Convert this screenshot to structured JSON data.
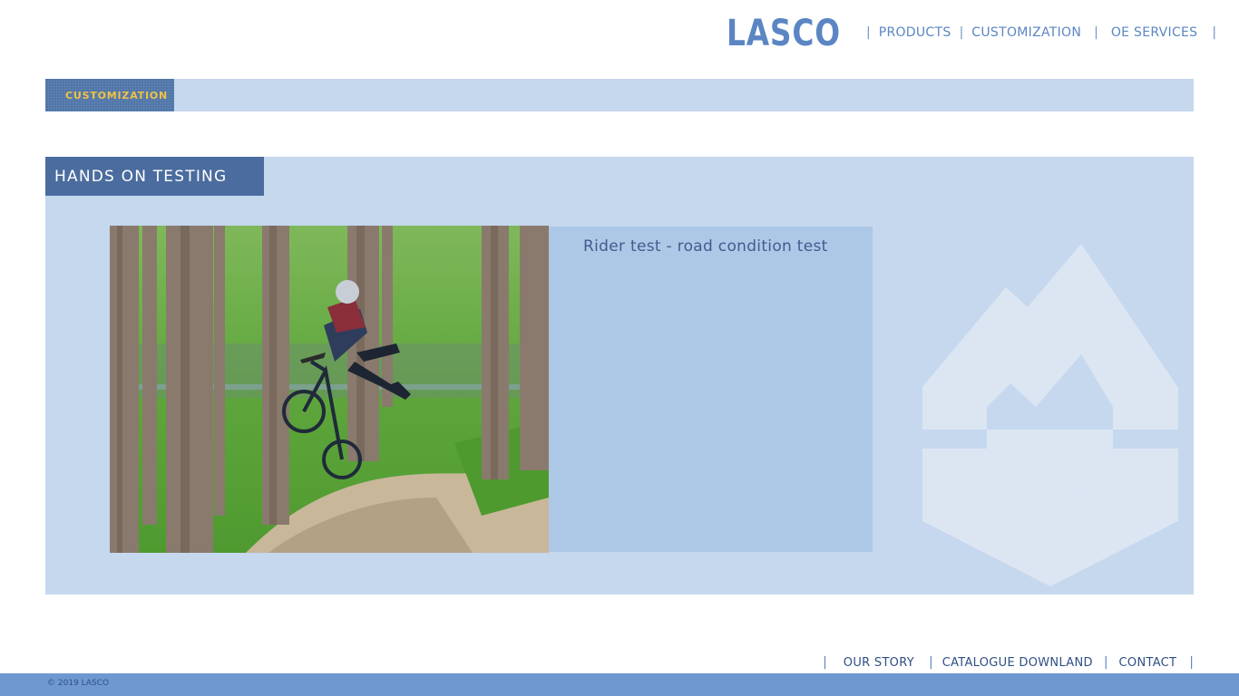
{
  "header": {
    "logo_text": "LASCO",
    "nav": [
      {
        "label": "PRODUCTS"
      },
      {
        "label": "CUSTOMIZATION"
      },
      {
        "label": "OE SERVICES"
      }
    ]
  },
  "breadcrumb": {
    "current": "CUSTOMIZATION"
  },
  "section": {
    "title": "HANDS ON TESTING",
    "caption": "Rider test - road condition test"
  },
  "footer": {
    "nav": [
      {
        "label": "OUR STORY"
      },
      {
        "label": "CATALOGUE DOWNLAND"
      },
      {
        "label": "CONTACT"
      }
    ],
    "copyright": "© 2019 LASCO"
  },
  "colors": {
    "brand_blue": "#5b86c3",
    "panel_bg": "#c5d8ee",
    "title_bg": "#4b6c9e",
    "accent_yellow": "#f0c243",
    "footer_bar": "#6f98d1"
  },
  "icons": {
    "watermark": "lasco-mountain-shield-icon"
  }
}
